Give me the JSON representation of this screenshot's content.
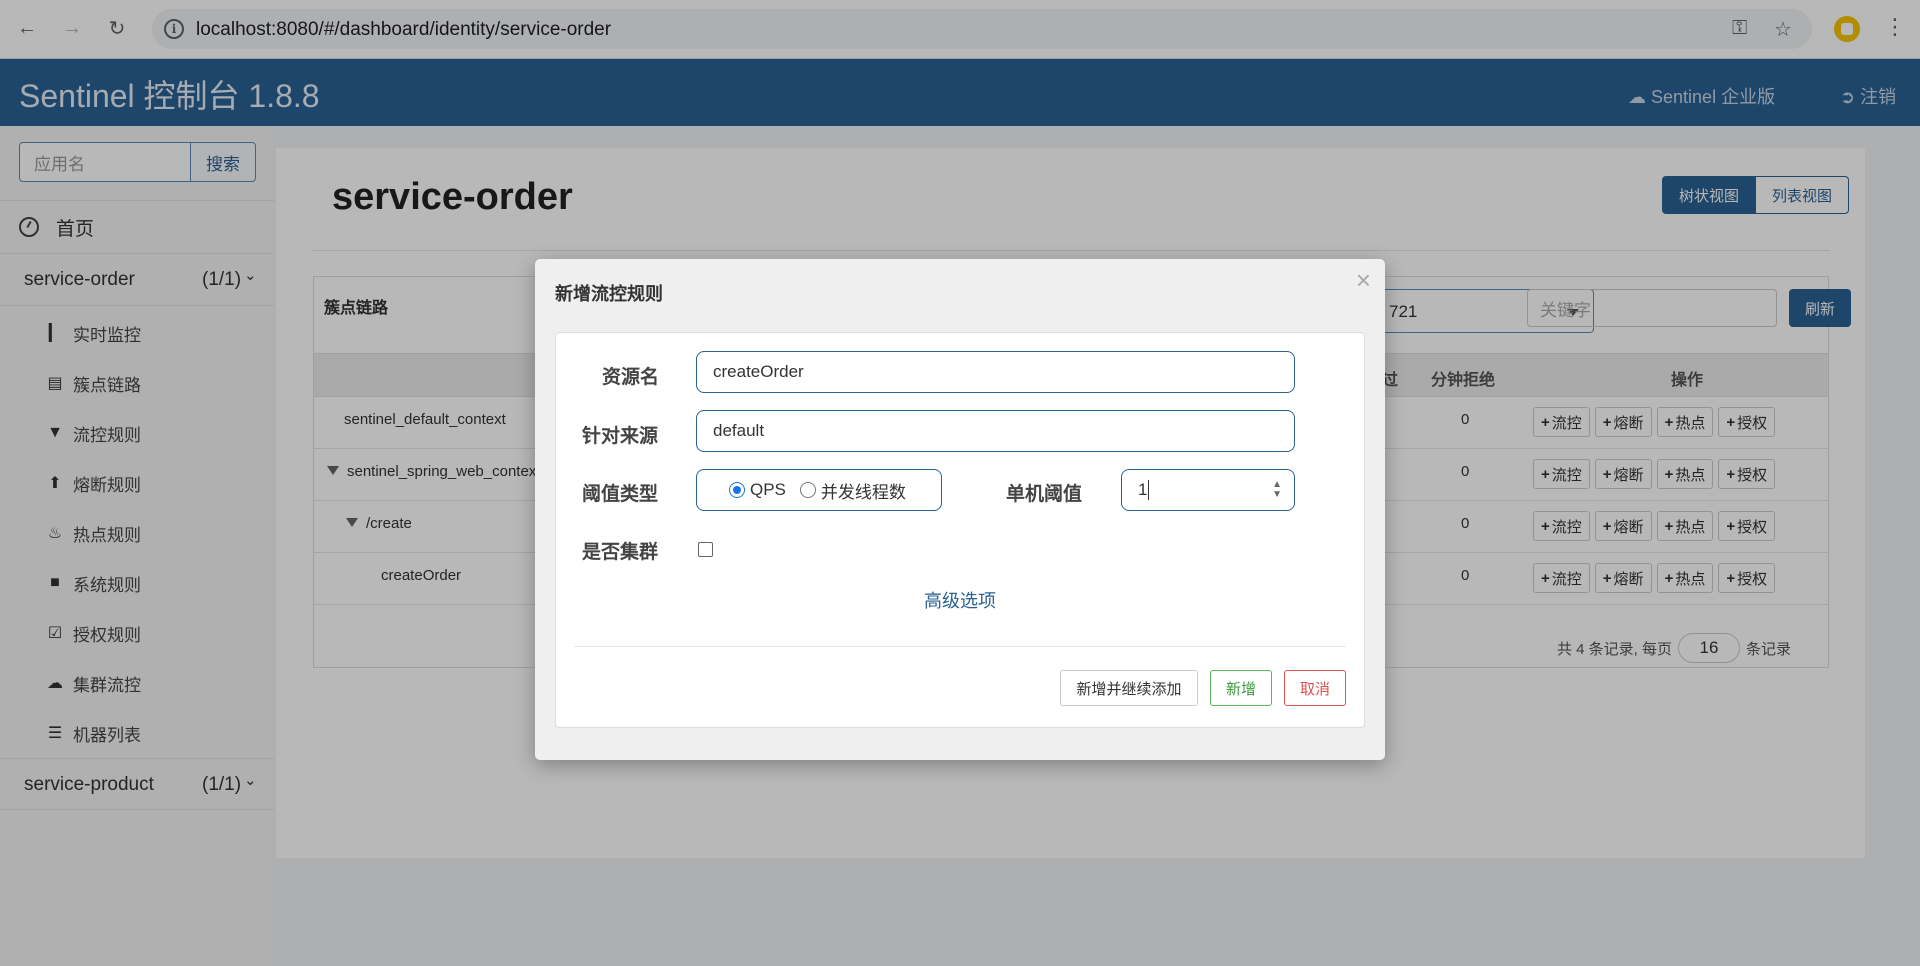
{
  "browser": {
    "url": "localhost:8080/#/dashboard/identity/service-order",
    "back_icon": "arrow-left-icon",
    "forward_icon": "arrow-right-icon",
    "reload_icon": "reload-icon"
  },
  "header": {
    "brand": "Sentinel 控制台 1.8.8",
    "enterprise_label": "Sentinel 企业版",
    "logout_label": "注销",
    "bg_color": "#2a6193"
  },
  "sidebar": {
    "search_placeholder": "应用名",
    "search_button": "搜索",
    "home_label": "首页",
    "apps": [
      {
        "name": "service-order",
        "count": "(1/1)",
        "items": [
          {
            "label": "实时监控",
            "icon": "bar-chart-icon"
          },
          {
            "label": "簇点链路",
            "icon": "list-icon"
          },
          {
            "label": "流控规则",
            "icon": "filter-icon"
          },
          {
            "label": "熔断规则",
            "icon": "bolt-icon"
          },
          {
            "label": "热点规则",
            "icon": "fire-icon"
          },
          {
            "label": "系统规则",
            "icon": "lock-icon"
          },
          {
            "label": "授权规则",
            "icon": "check-square-icon"
          },
          {
            "label": "集群流控",
            "icon": "cloud-icon"
          },
          {
            "label": "机器列表",
            "icon": "th-list-icon"
          }
        ]
      },
      {
        "name": "service-product",
        "count": "(1/1)"
      }
    ]
  },
  "main": {
    "title": "service-order",
    "tree_view": "树状视图",
    "list_view": "列表视图",
    "card_title": "簇点链路",
    "machine_value": "721",
    "keyword_placeholder": "关键字",
    "refresh_label": "刷新",
    "columns": {
      "pass": "过",
      "block_per_min": "分钟拒绝",
      "ops": "操作"
    },
    "rows": [
      {
        "resource": "sentinel_default_context",
        "block": "0",
        "expandable": false
      },
      {
        "resource": "sentinel_spring_web_contex",
        "block": "0",
        "expandable": true
      },
      {
        "resource": "/create",
        "block": "0",
        "expandable": true
      },
      {
        "resource": "createOrder",
        "block": "0",
        "expandable": false
      }
    ],
    "op_buttons": [
      "流控",
      "熔断",
      "热点",
      "授权"
    ],
    "pager": {
      "prefix": "共 4 条记录, 每页",
      "page_size": "16",
      "suffix": "条记录"
    }
  },
  "modal": {
    "title": "新增流控规则",
    "resource_label": "资源名",
    "resource_value": "createOrder",
    "origin_label": "针对来源",
    "origin_value": "default",
    "threshold_type_label": "阈值类型",
    "radio_qps": "QPS",
    "radio_threads": "并发线程数",
    "single_threshold_label": "单机阈值",
    "single_threshold_value": "1",
    "cluster_label": "是否集群",
    "advanced_link": "高级选项",
    "btn_add_continue": "新增并继续添加",
    "btn_add": "新增",
    "btn_cancel": "取消",
    "close_glyph": "×"
  }
}
